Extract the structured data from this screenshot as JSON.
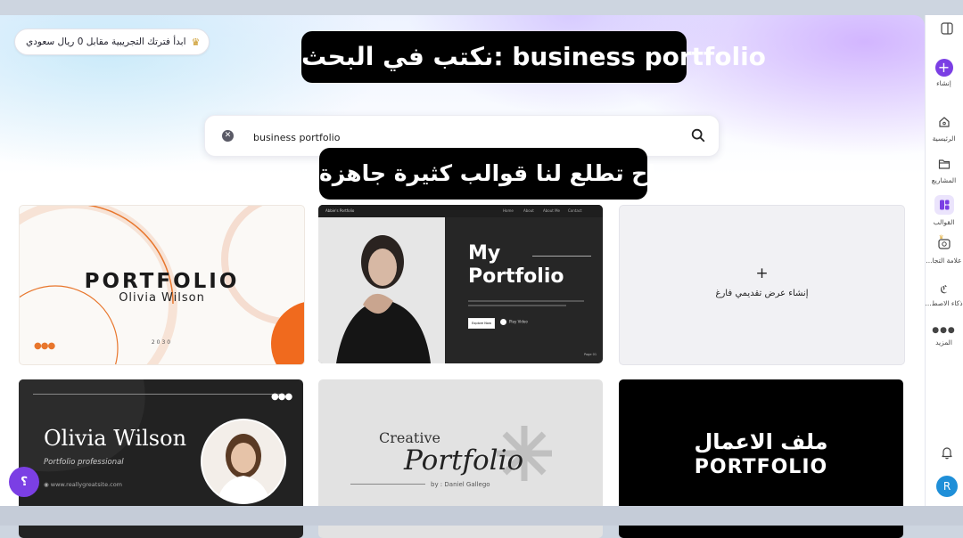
{
  "trial_banner": {
    "text": "ابدأ فترتك التجريبية مقابل 0 ريال سعودي",
    "icon": "crown-icon"
  },
  "captions": {
    "top": "نكتب في البحث: business portfolio",
    "middle": "راح تطلع لنا قوالب كثيرة جاهزة"
  },
  "search": {
    "value": "business portfolio"
  },
  "templates": {
    "t1": {
      "title": "PORTFOLIO",
      "name": "Olivia Wilson",
      "year": "2030"
    },
    "t2": {
      "line1": "My",
      "line2": "Portfolio",
      "brand": "Abbie's Portfolio",
      "nav": [
        "Home",
        "About",
        "About Me",
        "Contact"
      ],
      "button": "Explore Now",
      "play": "Play Video",
      "page": "Page 01"
    },
    "blank": {
      "plus": "+",
      "label": "إنشاء عرض تقديمي فارغ"
    },
    "t4": {
      "name": "Olivia Wilson",
      "role": "Portfolio professional",
      "site": "www.reallygreatsite.com"
    },
    "t5": {
      "line1": "Creative",
      "line2": "Portfolio",
      "by": "by : Daniel Gallego"
    },
    "t6": {
      "arabic": "ملف الاعمال",
      "english": "PORTFOLIO"
    }
  },
  "help": {
    "label": "؟"
  },
  "sidebar": {
    "create": "إنشاء",
    "home": "الرئيسية",
    "projects": "المشاريع",
    "templates": "القوالب",
    "brand": "علامة التجا...",
    "ai": "ذكاء الاصط...",
    "more": "المزيد",
    "user_initial": "R"
  },
  "colors": {
    "accent": "#7b3fe4",
    "orange": "#e8762c"
  }
}
